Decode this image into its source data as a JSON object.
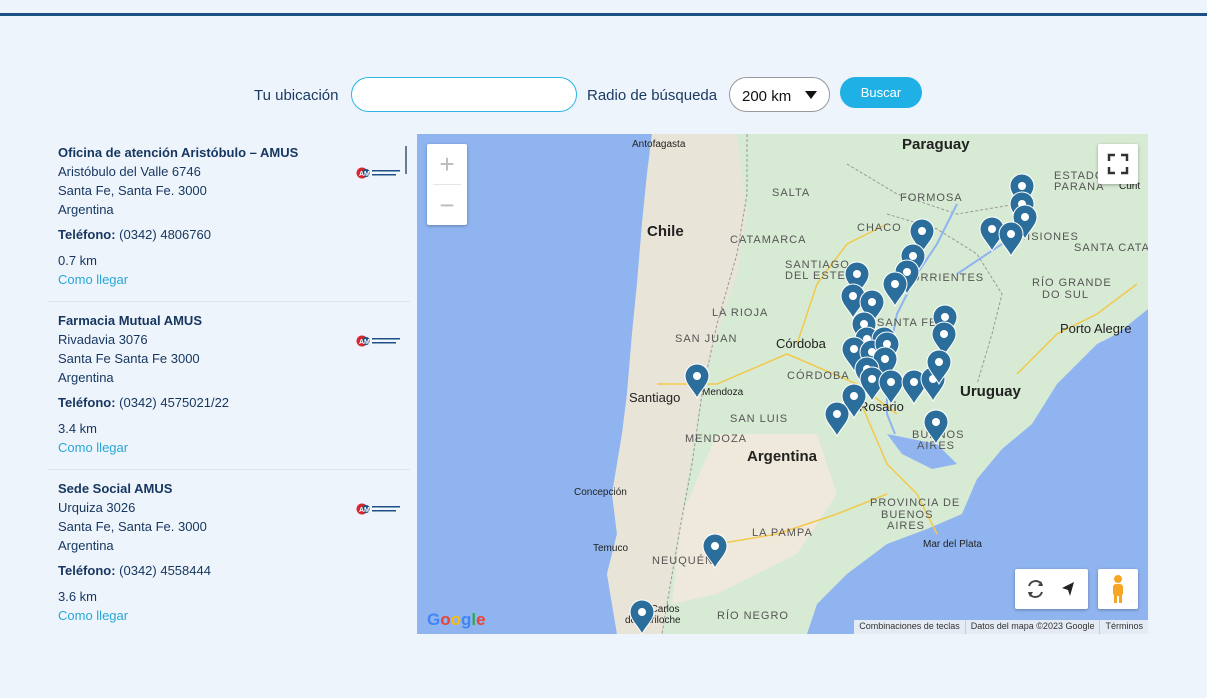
{
  "search": {
    "location_label": "Tu ubicación",
    "location_value": "",
    "radius_label": "Radio de búsqueda",
    "radius_value": "200 km",
    "button_label": "Buscar"
  },
  "results": [
    {
      "name": "Oficina de atención Aristóbulo – AMUS",
      "address": "Aristóbulo del Valle 6746",
      "city": "Santa Fe, Santa Fe. 3000",
      "country": "Argentina",
      "phone_label": "Teléfono:",
      "phone": "(0342) 4806760",
      "distance": "0.7 km",
      "link": "Como llegar",
      "logo_text": "AMUS"
    },
    {
      "name": "Farmacia Mutual AMUS",
      "address": "Rivadavia 3076",
      "city": "Santa Fe Santa Fe 3000",
      "country": "Argentina",
      "phone_label": "Teléfono:",
      "phone": "(0342) 4575021/22",
      "distance": "3.4 km",
      "link": "Como llegar",
      "logo_text": "AMUS"
    },
    {
      "name": "Sede Social AMUS",
      "address": "Urquiza 3026",
      "city": "Santa Fe, Santa Fe. 3000",
      "country": "Argentina",
      "phone_label": "Teléfono:",
      "phone": "(0342) 4558444",
      "distance": "3.6 km",
      "link": "Como llegar",
      "logo_text": "AMUS"
    }
  ],
  "map": {
    "labels": {
      "paraguay": "Paraguay",
      "antofagasta": "Antofagasta",
      "salta": "SALTA",
      "formosa": "FORMOSA",
      "estado_parana": "ESTADO DO",
      "parana": "PARANÁ",
      "chile": "Chile",
      "catamarca": "CATAMARCA",
      "chaco": "CHACO",
      "misiones": "MISIONES",
      "santa_catarina": "SANTA CATARINA",
      "santiago_estero": "SANTIAGO",
      "del_estero": "DEL ESTERO",
      "corrientes": "CORRIENTES",
      "rio_grande": "RÍO GRANDE",
      "do_sul": "DO SUL",
      "la_rioja": "LA RIOJA",
      "santa_fe": "SANTA FE",
      "porto_alegre": "Porto Alegre",
      "san_juan": "SAN JUAN",
      "cordoba_city": "Córdoba",
      "cordoba_prov": "CÓRDOBA",
      "uruguay": "Uruguay",
      "mendoza_city": "Mendoza",
      "santiago": "Santiago",
      "rosario": "Rosario",
      "san_luis": "SAN LUIS",
      "buenos_aires": "BUENOS",
      "aires": "AIRES",
      "mendoza_prov": "MENDOZA",
      "argentina": "Argentina",
      "concepcion": "Concepción",
      "provincia_de": "PROVINCIA DE",
      "buenos_aires2": "BUENOS",
      "aires2": "AIRES",
      "la_pampa": "LA PAMPA",
      "temuco": "Temuco",
      "neuquen": "NEUQUÉN",
      "mar_del_plata": "Mar del Plata",
      "san_carlos": "San Carlos",
      "de_bariloche": "de Bariloche",
      "rio_negro": "RÍO NEGRO",
      "curitiba": "Curit"
    },
    "google_logo": "Google",
    "attribution": {
      "shortcuts": "Combinaciones de teclas",
      "data": "Datos del mapa ©2023 Google",
      "terms": "Términos"
    },
    "zoom_in": "+",
    "zoom_out": "−"
  }
}
